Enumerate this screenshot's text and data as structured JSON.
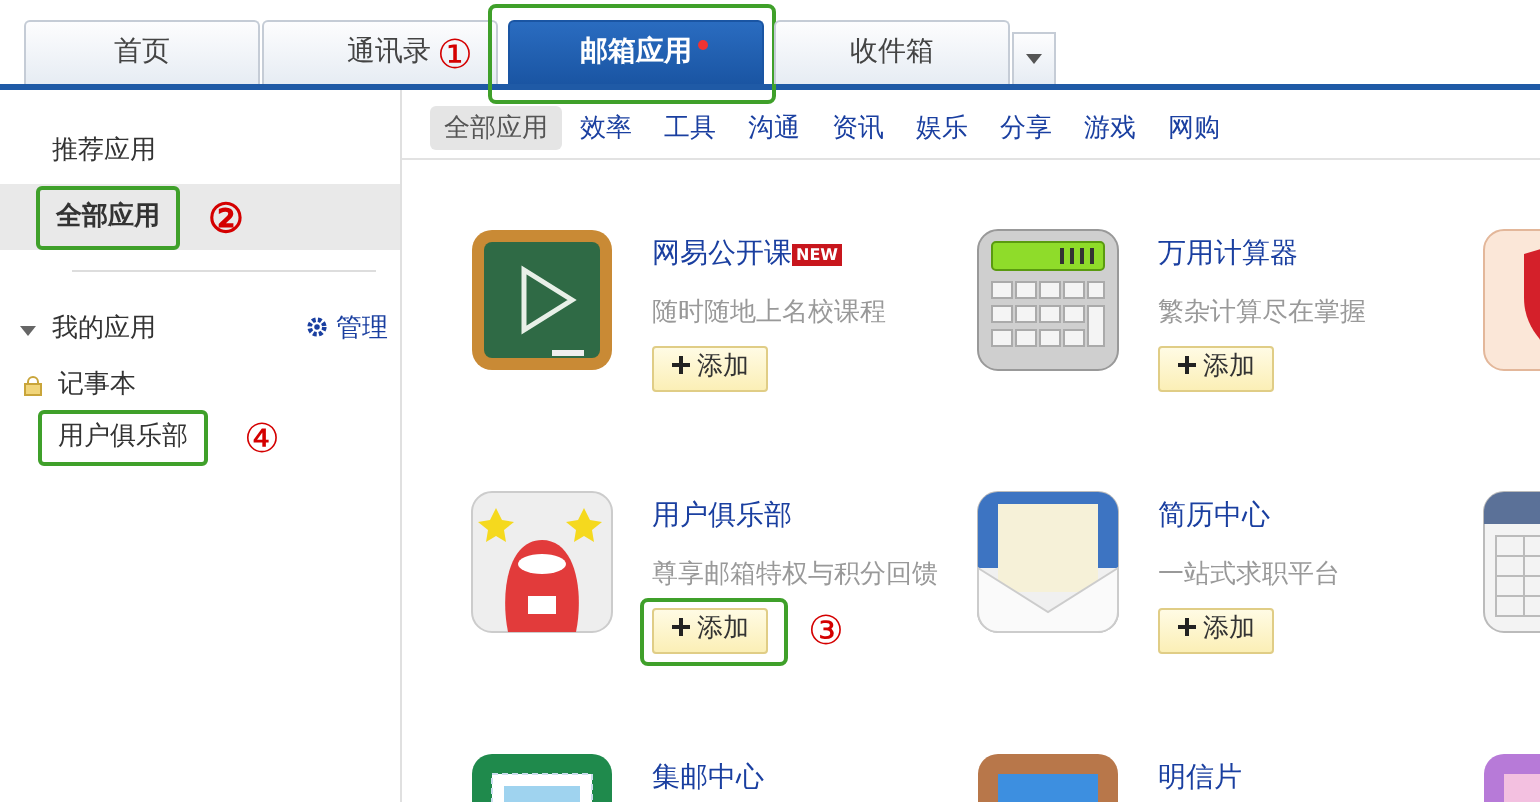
{
  "tabs": [
    {
      "label": "首页",
      "selected": false
    },
    {
      "label": "通讯录",
      "selected": false,
      "annotation": "①"
    },
    {
      "label": "邮箱应用",
      "selected": true,
      "highlighted": true,
      "new_dot": true
    },
    {
      "label": "收件箱",
      "selected": false
    }
  ],
  "sidebar": {
    "nav": [
      {
        "label": "推荐应用",
        "selected": false
      },
      {
        "label": "全部应用",
        "selected": true,
        "highlighted": true,
        "annotation": "②"
      }
    ],
    "my_apps": {
      "title": "我的应用",
      "expanded": true,
      "manage": "管理",
      "items": [
        {
          "label": "记事本",
          "locked": true
        },
        {
          "label": "用户俱乐部",
          "locked": false,
          "highlighted": true,
          "annotation": "④"
        }
      ]
    }
  },
  "categories": [
    {
      "label": "全部应用",
      "selected": true
    },
    {
      "label": "效率",
      "selected": false
    },
    {
      "label": "工具",
      "selected": false
    },
    {
      "label": "沟通",
      "selected": false
    },
    {
      "label": "资讯",
      "selected": false
    },
    {
      "label": "娱乐",
      "selected": false
    },
    {
      "label": "分享",
      "selected": false
    },
    {
      "label": "游戏",
      "selected": false
    },
    {
      "label": "网购",
      "selected": false
    }
  ],
  "apps": [
    {
      "kind": "chalkboard",
      "name": "网易公开课",
      "badge": "NEW",
      "description": "随时随地上名校课程",
      "add_label": "添加"
    },
    {
      "kind": "calculator",
      "name": "万用计算器",
      "description": "繁杂计算尽在掌握",
      "add_label": "添加"
    },
    {
      "kind": "shield"
    },
    {
      "kind": "mascot",
      "name": "用户俱乐部",
      "description": "尊享邮箱特权与积分回馈",
      "add_label": "添加",
      "add_highlighted": true,
      "annotation": "③"
    },
    {
      "kind": "envelope",
      "name": "简历中心",
      "description": "一站式求职平台",
      "add_label": "添加"
    },
    {
      "kind": "calendar"
    },
    {
      "kind": "stamp",
      "name": "集邮中心"
    },
    {
      "kind": "picture",
      "name": "明信片"
    },
    {
      "kind": "purple"
    }
  ]
}
